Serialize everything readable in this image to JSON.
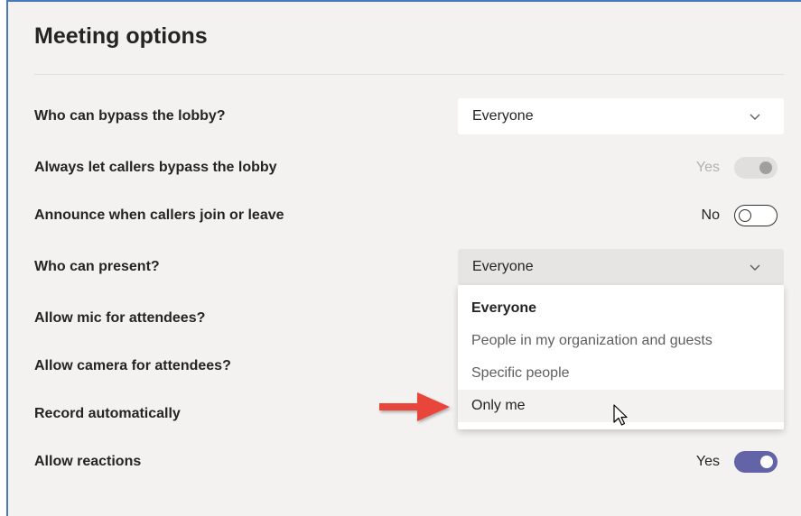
{
  "panel": {
    "title": "Meeting options"
  },
  "rows": {
    "bypass_lobby": {
      "label": "Who can bypass the lobby?",
      "value": "Everyone"
    },
    "callers_bypass": {
      "label": "Always let callers bypass the lobby",
      "toggle_text": "Yes",
      "state": "on-disabled"
    },
    "announce_callers": {
      "label": "Announce when callers join or leave",
      "toggle_text": "No",
      "state": "off"
    },
    "who_present": {
      "label": "Who can present?",
      "value": "Everyone"
    },
    "allow_mic": {
      "label": "Allow mic for attendees?"
    },
    "allow_camera": {
      "label": "Allow camera for attendees?"
    },
    "record_auto": {
      "label": "Record automatically"
    },
    "allow_reactions": {
      "label": "Allow reactions",
      "toggle_text": "Yes",
      "state": "on"
    }
  },
  "present_dropdown": {
    "options": [
      "Everyone",
      "People in my organization and guests",
      "Specific people",
      "Only me"
    ],
    "selected": "Everyone",
    "hovered": "Only me"
  },
  "colors": {
    "accent": "#6264a7",
    "arrow": "#e8443a",
    "panel_bg": "#f3f2f1"
  },
  "icons": {
    "chevron": "chevron-down-icon",
    "pointer": "cursor-arrow-icon",
    "annotation": "red-arrow-icon"
  }
}
